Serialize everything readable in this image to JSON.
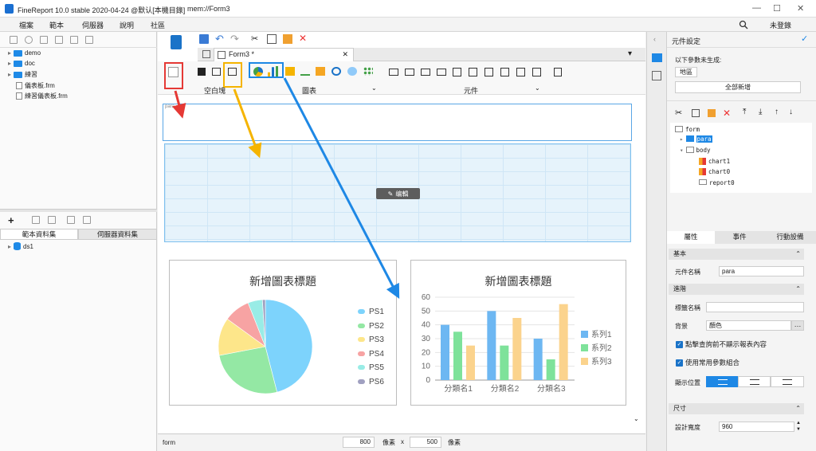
{
  "titlebar": {
    "app_title": "FineReport 10.0 stable 2020-04-24 @默认[本機目錄]",
    "doc_path": "mem://Form3",
    "minimize": "—",
    "maximize": "☐",
    "close": "✕"
  },
  "menubar": {
    "items": [
      "檔案",
      "範本",
      "伺服器",
      "說明",
      "社區"
    ],
    "login": "未登錄"
  },
  "left": {
    "tree": [
      "demo",
      "doc",
      "練習",
      "儀表板.frm",
      "練習儀表板.frm"
    ],
    "tabs": [
      "範本資料集",
      "伺服器資料集"
    ],
    "datasets": [
      "ds1"
    ]
  },
  "center": {
    "tab_label": "Form3 *",
    "toolbar_groups": [
      "空白塊",
      "圖表",
      "元件"
    ],
    "para_label": "para",
    "edit_label": "编輯",
    "status": {
      "name": "form",
      "width": "800",
      "unit1": "像素",
      "x": "x",
      "height": "500",
      "unit2": "像素"
    }
  },
  "pie_chart": {
    "title": "新增圖表標題",
    "legend": [
      "PS1",
      "PS2",
      "PS3",
      "PS4",
      "PS5",
      "PS6"
    ],
    "colors": [
      "#7dd3fc",
      "#94e8a4",
      "#fde68a",
      "#f7a3a3",
      "#99ece6",
      "#a0a0c0"
    ]
  },
  "bar_chart": {
    "title": "新增圖表標題",
    "yticks": [
      "0",
      "10",
      "20",
      "30",
      "40",
      "50",
      "60"
    ],
    "categories": [
      "分類名1",
      "分類名2",
      "分類名3"
    ],
    "series": [
      "系列1",
      "系列2",
      "系列3"
    ],
    "colors": [
      "#6db7f2",
      "#7ee29a",
      "#fbd38d"
    ]
  },
  "chart_data": [
    {
      "type": "pie",
      "title": "新增圖表標題",
      "labels": [
        "PS1",
        "PS2",
        "PS3",
        "PS4",
        "PS5",
        "PS6"
      ],
      "values": [
        46,
        26,
        13,
        9,
        5,
        1
      ]
    },
    {
      "type": "bar",
      "title": "新增圖表標題",
      "categories": [
        "分類名1",
        "分類名2",
        "分類名3"
      ],
      "ylim": [
        0,
        60
      ],
      "series": [
        {
          "name": "系列1",
          "values": [
            40,
            50,
            30
          ]
        },
        {
          "name": "系列2",
          "values": [
            35,
            25,
            15
          ]
        },
        {
          "name": "系列3",
          "values": [
            25,
            45,
            55
          ]
        }
      ]
    }
  ],
  "right": {
    "header": "元件設定",
    "not_generated": "以下參數未生成:",
    "param": "地區",
    "add_all": "全部新增",
    "tree": [
      "form",
      "para",
      "body",
      "chart1",
      "chart0",
      "report0"
    ],
    "tabs": [
      "屬性",
      "事件",
      "行動設備"
    ],
    "sec_basic": "基本",
    "name_label": "元件名稱",
    "name_value": "para",
    "sec_adv": "進階",
    "label_name": "標籤名稱",
    "bg_label": "背景",
    "bg_value": "顏色",
    "chk1": "點擊查詢前不顯示報表內容",
    "chk2": "使用常用參數組合",
    "display_pos": "顯示位置",
    "sec_size": "尺寸",
    "design_width_label": "設計寬度",
    "design_width_value": "960"
  }
}
